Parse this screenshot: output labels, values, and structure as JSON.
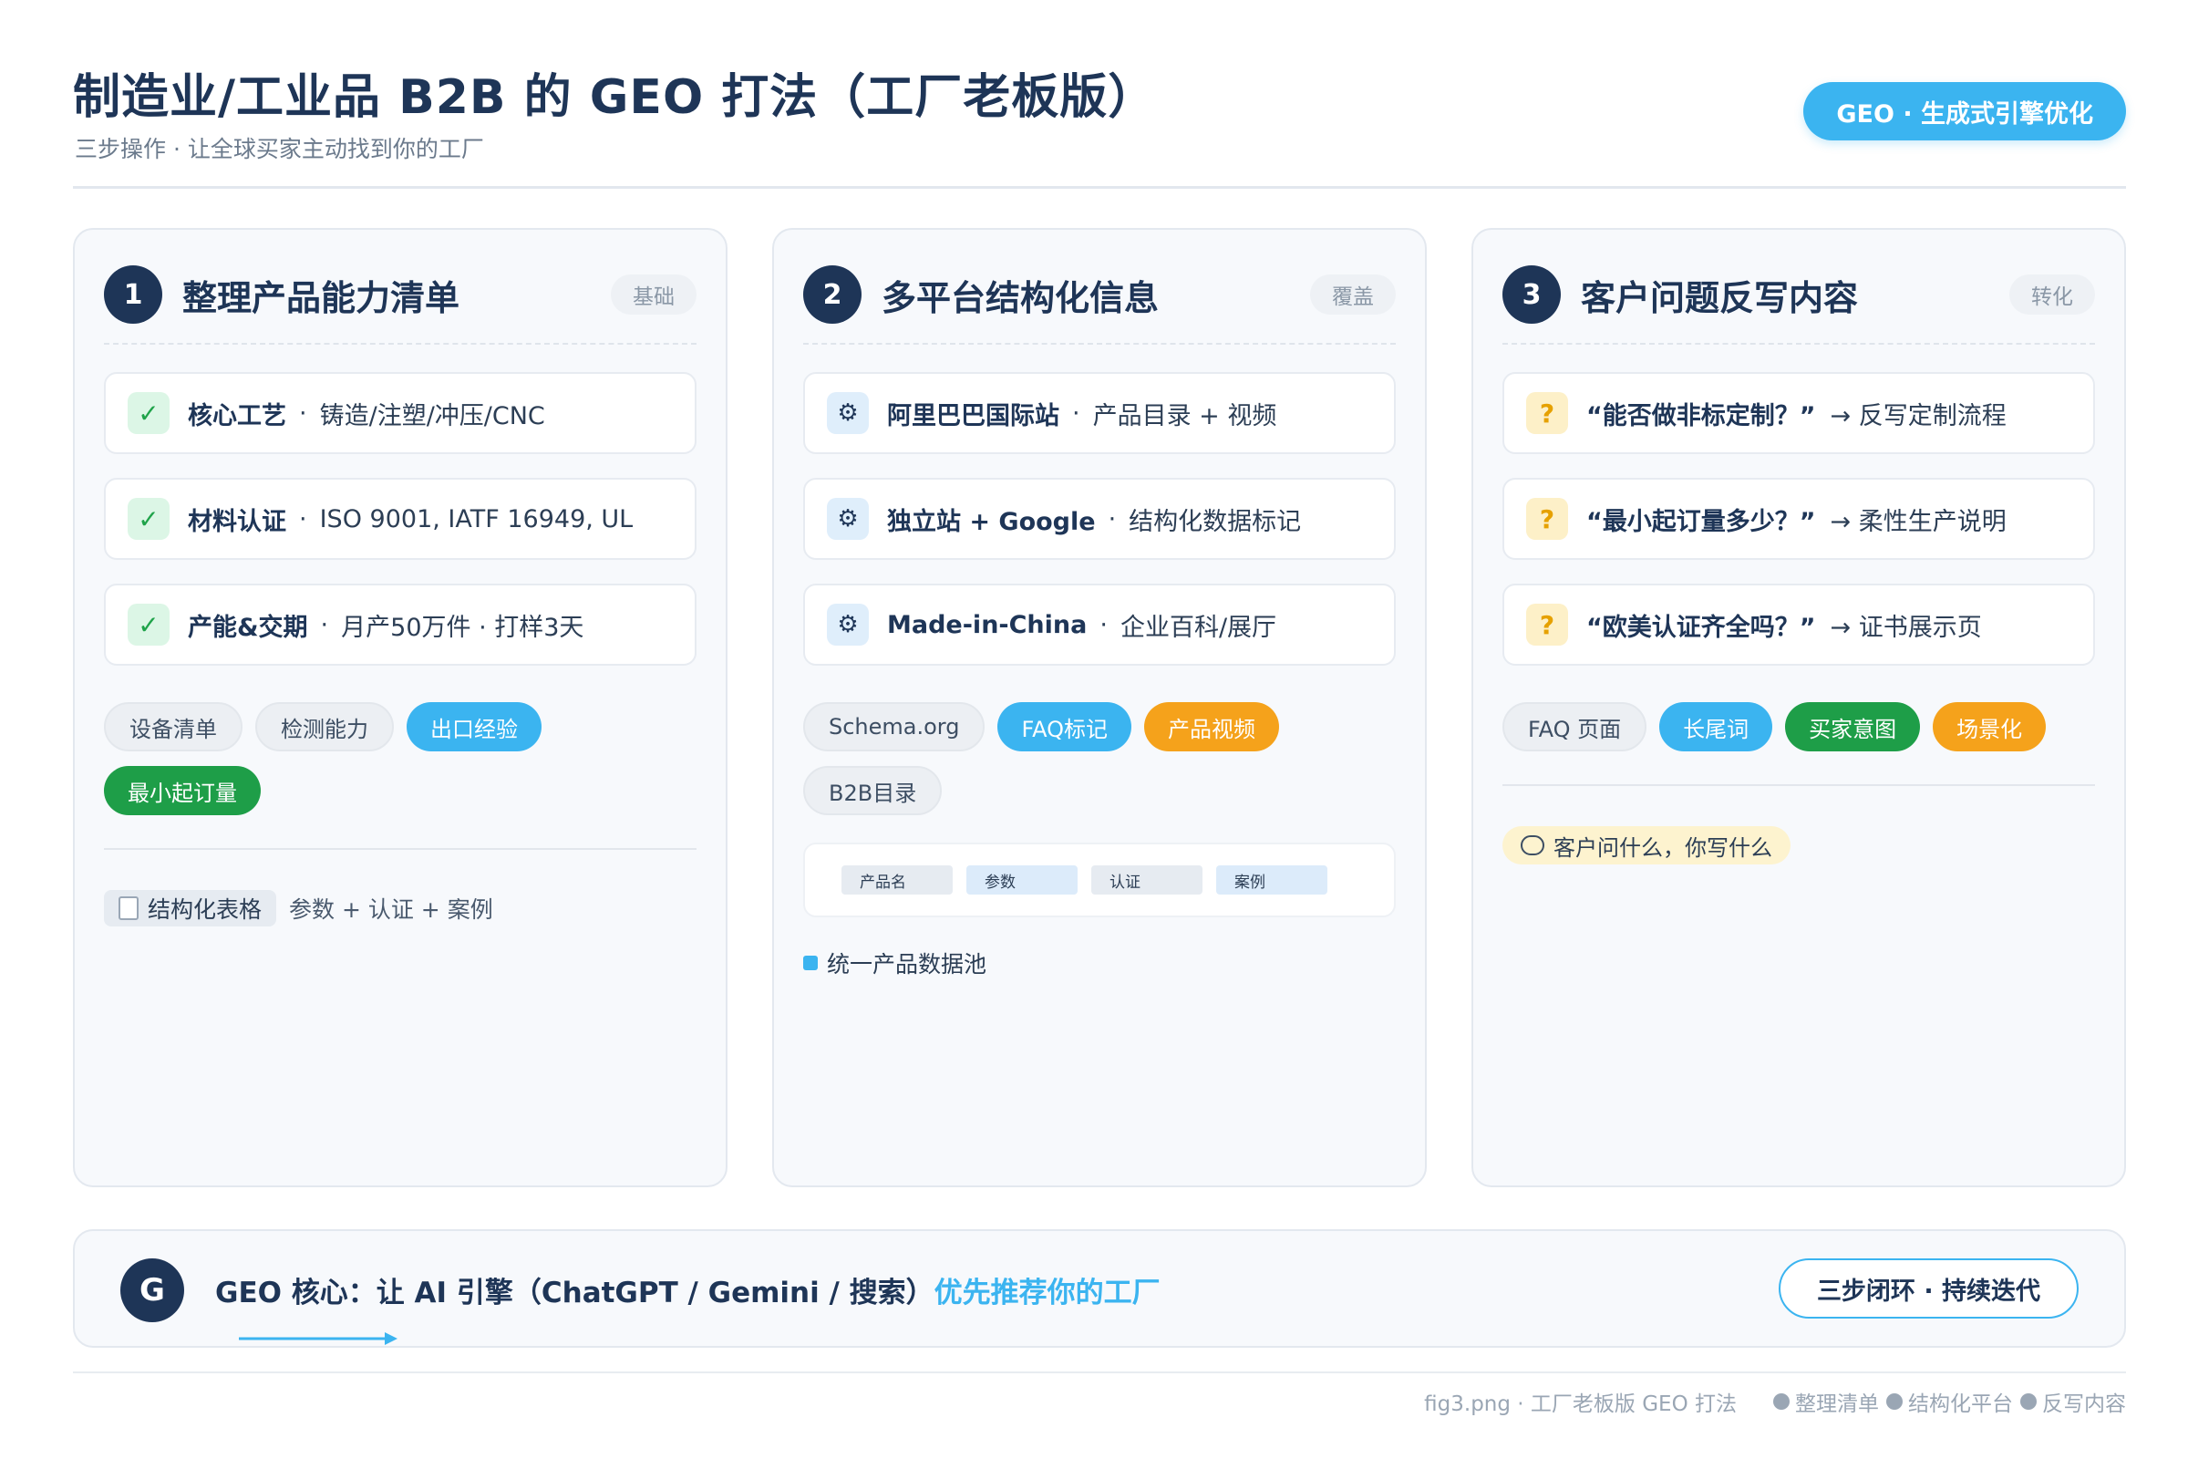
{
  "header": {
    "title": "制造业/工业品 B2B 的 GEO 打法（工厂老板版）",
    "subtitle": "三步操作 · 让全球买家主动找到你的工厂",
    "badge": "GEO · 生成式引擎优化"
  },
  "cards": [
    {
      "num": "1",
      "title": "整理产品能力清单",
      "tag": "基础",
      "items": [
        {
          "strong": "核心工艺",
          "sep": "·",
          "rest": "铸造/注塑/冲压/CNC"
        },
        {
          "strong": "材料认证",
          "sep": "·",
          "rest": "ISO 9001, IATF 16949, UL"
        },
        {
          "strong": "产能&交期",
          "sep": "·",
          "rest": "月产50万件 · 打样3天"
        }
      ],
      "chips": [
        "设备清单",
        "检测能力",
        "出口经验",
        "最小起订量"
      ],
      "note_label": "结构化表格",
      "note_text": "参数 + 认证 + 案例"
    },
    {
      "num": "2",
      "title": "多平台结构化信息",
      "tag": "覆盖",
      "items": [
        {
          "strong": "阿里巴巴国际站",
          "sep": "·",
          "rest": "产品目录 + 视频"
        },
        {
          "strong": "独立站 + Google",
          "sep": "·",
          "rest": "结构化数据标记"
        },
        {
          "strong": "Made-in-China",
          "sep": "·",
          "rest": "企业百科/展厅"
        }
      ],
      "chips": [
        "Schema.org",
        "FAQ标记",
        "产品视频",
        "B2B目录"
      ],
      "pool_cells": [
        "产品名",
        "参数",
        "认证",
        "案例"
      ],
      "pool_label": "统一产品数据池"
    },
    {
      "num": "3",
      "title": "客户问题反写内容",
      "tag": "转化",
      "items": [
        {
          "strong": "“能否做非标定制？”",
          "rest": "→ 反写定制流程"
        },
        {
          "strong": "“最小起订量多少？”",
          "rest": "→ 柔性生产说明"
        },
        {
          "strong": "“欧美认证齐全吗？”",
          "rest": "→ 证书展示页"
        }
      ],
      "chips": [
        "FAQ 页面",
        "长尾词",
        "买家意图",
        "场景化"
      ],
      "speech": "客户问什么，你写什么"
    }
  ],
  "banner": {
    "badge": "G",
    "text": "GEO 核心：让 AI 引擎（ChatGPT / Gemini / 搜索）",
    "accent": "优先推荐你的工厂",
    "pill": "三步闭环 · 持续迭代"
  },
  "footer": {
    "source": "fig3.png · 工厂老板版 GEO 打法",
    "legend": [
      "整理清单",
      "结构化平台",
      "反写内容"
    ]
  },
  "colors": {
    "navy": "#1e3557",
    "accent_blue": "#3bb4f0",
    "green": "#1e9e48",
    "orange": "#f5a21b"
  }
}
